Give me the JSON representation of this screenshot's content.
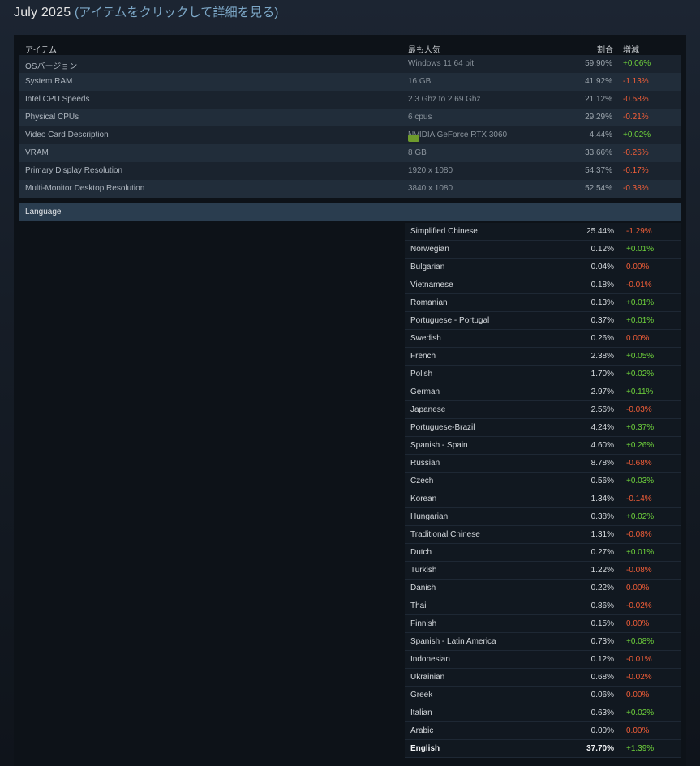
{
  "title": {
    "month": "July 2025",
    "subtitle": "(アイテムをクリックして詳細を見る)"
  },
  "header": {
    "item": "アイテム",
    "popular": "最も人気",
    "share": "割合",
    "change": "増減"
  },
  "rows": [
    {
      "name": "OSバージョン",
      "popular": "Windows 11 64 bit",
      "pct": "59.90%",
      "chg": "+0.06%",
      "sign": "pos"
    },
    {
      "name": "System RAM",
      "popular": "16 GB",
      "pct": "41.92%",
      "chg": "-1.13%",
      "sign": "neg"
    },
    {
      "name": "Intel CPU Speeds",
      "popular": "2.3 Ghz to 2.69 Ghz",
      "pct": "21.12%",
      "chg": "-0.58%",
      "sign": "neg"
    },
    {
      "name": "Physical CPUs",
      "popular": "6 cpus",
      "pct": "29.29%",
      "chg": "-0.21%",
      "sign": "neg"
    },
    {
      "name": "Video Card Description",
      "popular": "NVIDIA GeForce RTX 3060",
      "pct": "4.44%",
      "chg": "+0.02%",
      "sign": "pos",
      "icon": "nvidia-icon"
    },
    {
      "name": "VRAM",
      "popular": "8 GB",
      "pct": "33.66%",
      "chg": "-0.26%",
      "sign": "neg"
    },
    {
      "name": "Primary Display Resolution",
      "popular": "1920 x 1080",
      "pct": "54.37%",
      "chg": "-0.17%",
      "sign": "neg"
    },
    {
      "name": "Multi-Monitor Desktop Resolution",
      "popular": "3840 x 1080",
      "pct": "52.54%",
      "chg": "-0.38%",
      "sign": "neg"
    }
  ],
  "language_label": "Language",
  "languages": [
    {
      "name": "Simplified Chinese",
      "pct": "25.44%",
      "chg": "-1.29%",
      "sign": "neg"
    },
    {
      "name": "Norwegian",
      "pct": "0.12%",
      "chg": "+0.01%",
      "sign": "pos"
    },
    {
      "name": "Bulgarian",
      "pct": "0.04%",
      "chg": "0.00%",
      "sign": "zero"
    },
    {
      "name": "Vietnamese",
      "pct": "0.18%",
      "chg": "-0.01%",
      "sign": "neg"
    },
    {
      "name": "Romanian",
      "pct": "0.13%",
      "chg": "+0.01%",
      "sign": "pos"
    },
    {
      "name": "Portuguese - Portugal",
      "pct": "0.37%",
      "chg": "+0.01%",
      "sign": "pos"
    },
    {
      "name": "Swedish",
      "pct": "0.26%",
      "chg": "0.00%",
      "sign": "zero"
    },
    {
      "name": "French",
      "pct": "2.38%",
      "chg": "+0.05%",
      "sign": "pos"
    },
    {
      "name": "Polish",
      "pct": "1.70%",
      "chg": "+0.02%",
      "sign": "pos"
    },
    {
      "name": "German",
      "pct": "2.97%",
      "chg": "+0.11%",
      "sign": "pos"
    },
    {
      "name": "Japanese",
      "pct": "2.56%",
      "chg": "-0.03%",
      "sign": "neg"
    },
    {
      "name": "Portuguese-Brazil",
      "pct": "4.24%",
      "chg": "+0.37%",
      "sign": "pos"
    },
    {
      "name": "Spanish - Spain",
      "pct": "4.60%",
      "chg": "+0.26%",
      "sign": "pos"
    },
    {
      "name": "Russian",
      "pct": "8.78%",
      "chg": "-0.68%",
      "sign": "neg"
    },
    {
      "name": "Czech",
      "pct": "0.56%",
      "chg": "+0.03%",
      "sign": "pos"
    },
    {
      "name": "Korean",
      "pct": "1.34%",
      "chg": "-0.14%",
      "sign": "neg"
    },
    {
      "name": "Hungarian",
      "pct": "0.38%",
      "chg": "+0.02%",
      "sign": "pos"
    },
    {
      "name": "Traditional Chinese",
      "pct": "1.31%",
      "chg": "-0.08%",
      "sign": "neg"
    },
    {
      "name": "Dutch",
      "pct": "0.27%",
      "chg": "+0.01%",
      "sign": "pos"
    },
    {
      "name": "Turkish",
      "pct": "1.22%",
      "chg": "-0.08%",
      "sign": "neg"
    },
    {
      "name": "Danish",
      "pct": "0.22%",
      "chg": "0.00%",
      "sign": "zero"
    },
    {
      "name": "Thai",
      "pct": "0.86%",
      "chg": "-0.02%",
      "sign": "neg"
    },
    {
      "name": "Finnish",
      "pct": "0.15%",
      "chg": "0.00%",
      "sign": "zero"
    },
    {
      "name": "Spanish - Latin America",
      "pct": "0.73%",
      "chg": "+0.08%",
      "sign": "pos"
    },
    {
      "name": "Indonesian",
      "pct": "0.12%",
      "chg": "-0.01%",
      "sign": "neg"
    },
    {
      "name": "Ukrainian",
      "pct": "0.68%",
      "chg": "-0.02%",
      "sign": "neg"
    },
    {
      "name": "Greek",
      "pct": "0.06%",
      "chg": "0.00%",
      "sign": "zero"
    },
    {
      "name": "Italian",
      "pct": "0.63%",
      "chg": "+0.02%",
      "sign": "pos"
    },
    {
      "name": "Arabic",
      "pct": "0.00%",
      "chg": "0.00%",
      "sign": "zero"
    },
    {
      "name": "English",
      "pct": "37.70%",
      "chg": "+1.39%",
      "sign": "pos",
      "bold": true
    }
  ]
}
